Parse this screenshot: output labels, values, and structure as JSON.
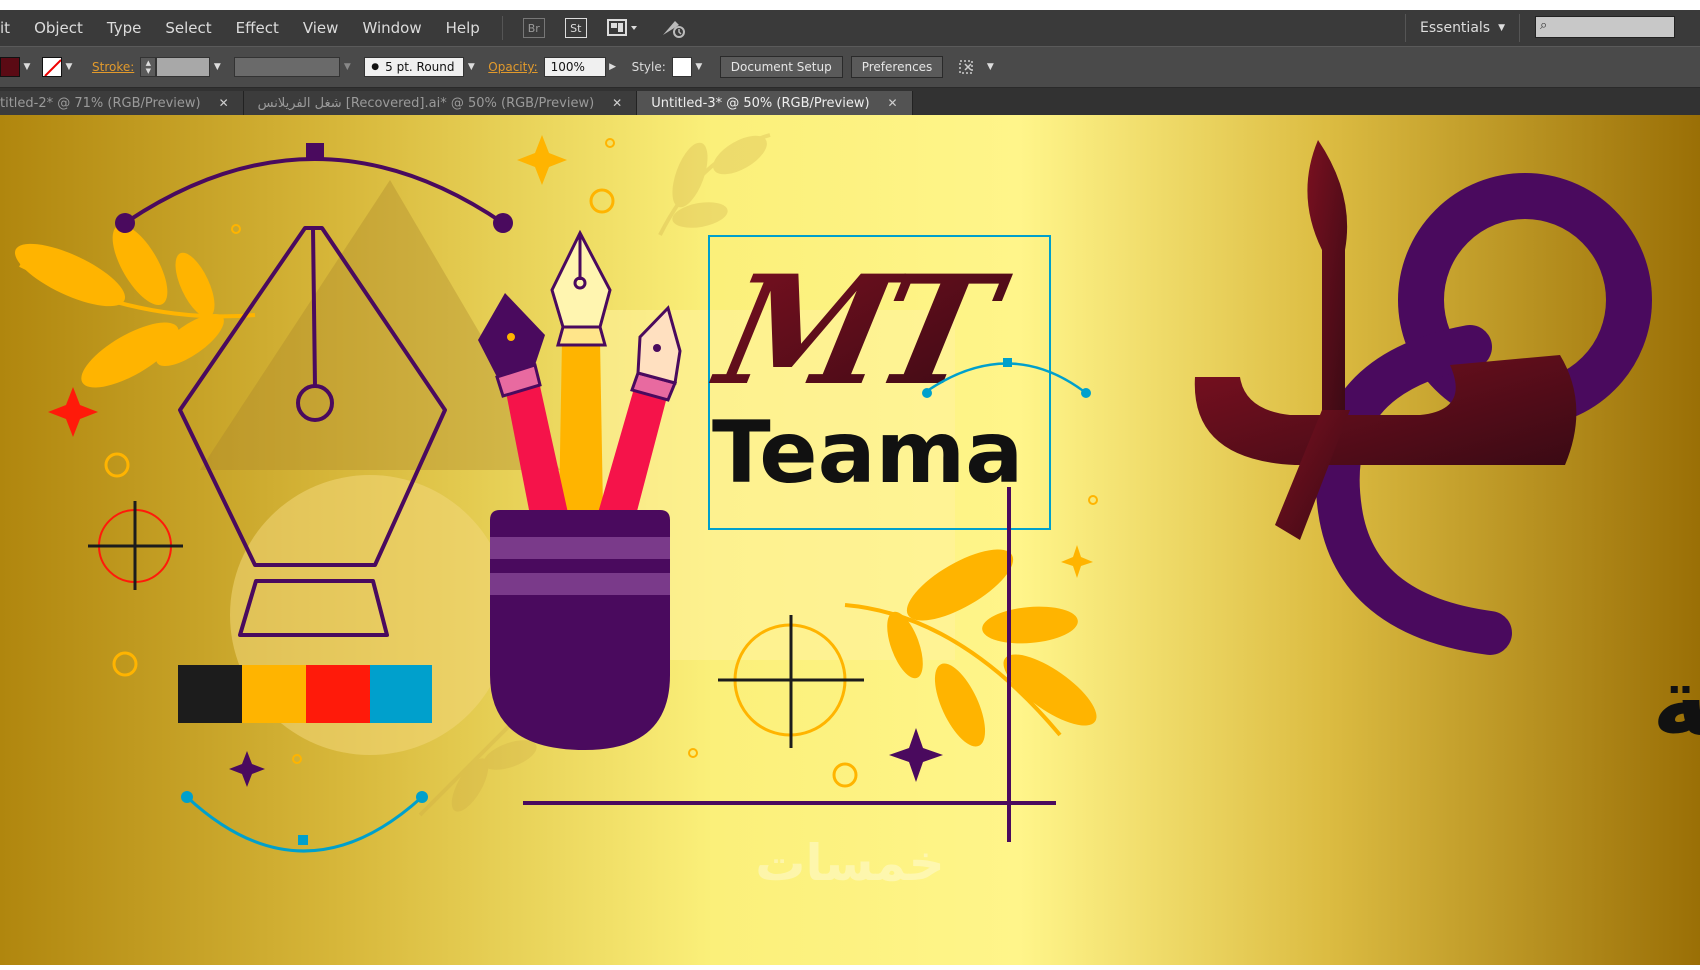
{
  "menu": {
    "items": [
      "it",
      "Object",
      "Type",
      "Select",
      "Effect",
      "View",
      "Window",
      "Help"
    ],
    "bridge_icon": "Br",
    "stock_icon": "St",
    "workspace": "Essentials"
  },
  "control": {
    "stroke_label": "Stroke:",
    "brush_label": "5 pt. Round",
    "opacity_label": "Opacity:",
    "opacity_value": "100%",
    "style_label": "Style:",
    "document_setup": "Document Setup",
    "preferences": "Preferences",
    "fill_color": "#5a0a14"
  },
  "tabs": [
    {
      "label": "titled-2* @ 71% (RGB/Preview)",
      "active": false
    },
    {
      "label": "شغل الفريلانس [Recovered].ai* @ 50% (RGB/Preview)",
      "active": false
    },
    {
      "label": "Untitled-3* @ 50% (RGB/Preview)",
      "active": true
    }
  ],
  "artwork": {
    "logo_initials": "MT",
    "logo_word": "Teama",
    "arabic_name": "محمود طعيمة",
    "watermark": "خمسات",
    "palette": [
      "#1c1c1c",
      "#ffb400",
      "#ff1a0a",
      "#00a0cc"
    ],
    "accent_purple": "#4a0a5e",
    "accent_maroon": "#5a0a14"
  }
}
